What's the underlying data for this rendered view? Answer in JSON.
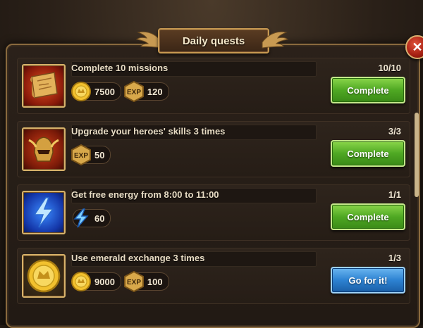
{
  "window": {
    "title": "Daily quests"
  },
  "quests": [
    {
      "title": "Complete 10 missions",
      "progress": "10/10",
      "icon": "scroll-map-icon",
      "rewards": [
        {
          "type": "gold",
          "icon": "gold-coin-icon",
          "value": "7500"
        },
        {
          "type": "exp",
          "icon": "exp-hex-icon",
          "value": "120"
        }
      ],
      "action": {
        "label": "Complete",
        "style": "green"
      }
    },
    {
      "title": "Upgrade your heroes' skills 3 times",
      "progress": "3/3",
      "icon": "helmet-icon",
      "rewards": [
        {
          "type": "exp",
          "icon": "exp-hex-icon",
          "value": "50"
        }
      ],
      "action": {
        "label": "Complete",
        "style": "green"
      }
    },
    {
      "title": "Get free energy from 8:00 to 11:00",
      "progress": "1/1",
      "icon": "lightning-icon",
      "rewards": [
        {
          "type": "energy",
          "icon": "energy-bolt-icon",
          "value": "60"
        }
      ],
      "action": {
        "label": "Complete",
        "style": "green"
      }
    },
    {
      "title": "Use emerald exchange 3 times",
      "progress": "1/3",
      "icon": "gold-crown-coin-icon",
      "rewards": [
        {
          "type": "gold",
          "icon": "gold-coin-icon",
          "value": "9000"
        },
        {
          "type": "exp",
          "icon": "exp-hex-icon",
          "value": "100"
        }
      ],
      "action": {
        "label": "Go for it!",
        "style": "blue"
      }
    }
  ],
  "colors": {
    "complete": "#4fa823",
    "go": "#2d82d2",
    "frame": "#d7b26a"
  }
}
